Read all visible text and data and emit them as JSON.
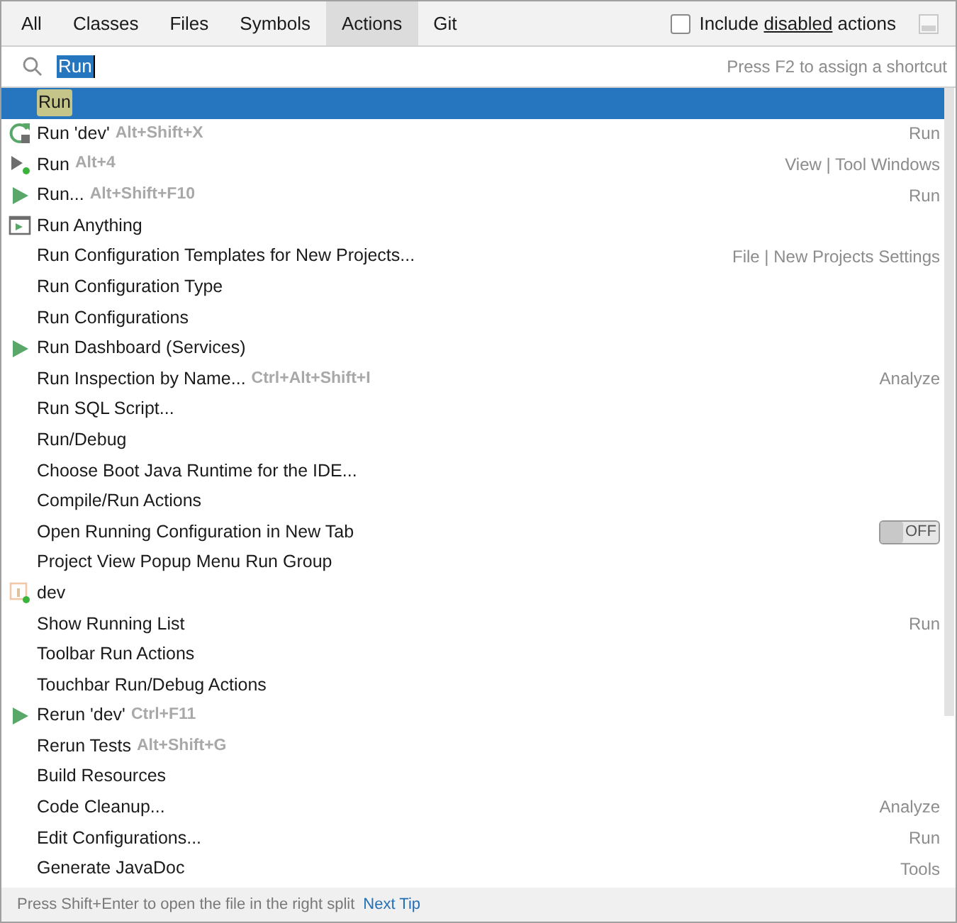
{
  "tabs": [
    {
      "label": "All",
      "selected": false
    },
    {
      "label": "Classes",
      "selected": false
    },
    {
      "label": "Files",
      "selected": false
    },
    {
      "label": "Symbols",
      "selected": false
    },
    {
      "label": "Actions",
      "selected": true
    },
    {
      "label": "Git",
      "selected": false
    }
  ],
  "include_disabled": {
    "label": "Include **disabled** actions",
    "checked": false
  },
  "search": {
    "value": "Run",
    "hint": "Press F2 to assign a shortcut"
  },
  "results": [
    {
      "name": "Run",
      "selected": true
    },
    {
      "name": "Run 'dev'",
      "shortcut": "Alt+Shift+X",
      "group": "Run",
      "kind": "rerun",
      "selected": false
    },
    {
      "name": "Run",
      "shortcut": "Alt+4",
      "group": "View | Tool Windows",
      "kind": "run-window",
      "selected": false
    },
    {
      "name": "Run...",
      "shortcut": "Alt+Shift+F10",
      "group": "Run",
      "kind": "play",
      "selected": false
    },
    {
      "name": "Run Anything",
      "kind": "run-anything",
      "selected": false
    },
    {
      "name": "Run Configuration Templates for New Projects...",
      "group": "File | New Projects Settings",
      "selected": false
    },
    {
      "name": "Run Configuration Type",
      "selected": false
    },
    {
      "name": "Run Configurations",
      "selected": false
    },
    {
      "name": "Run Dashboard (Services)",
      "kind": "play",
      "selected": false
    },
    {
      "name": "Run Inspection by Name...",
      "shortcut": "Ctrl+Alt+Shift+I",
      "group": "Analyze",
      "selected": false
    },
    {
      "name": "Run SQL Script...",
      "selected": false
    },
    {
      "name": "Run/Debug",
      "selected": false
    },
    {
      "name": "Choose Boot Java Runtime for the IDE...",
      "selected": false
    },
    {
      "name": "Compile/Run Actions",
      "selected": false
    },
    {
      "name": "Open Running Configuration in New Tab",
      "toggle": {
        "on": false,
        "label": "OFF"
      },
      "selected": false
    },
    {
      "name": "Project View Popup Menu Run Group",
      "selected": false
    },
    {
      "name": "dev",
      "kind": "config",
      "selected": false
    },
    {
      "name": "Show Running List",
      "group": "Run",
      "selected": false
    },
    {
      "name": "Toolbar Run Actions",
      "selected": false
    },
    {
      "name": "Touchbar Run/Debug Actions",
      "selected": false
    },
    {
      "name": "Rerun 'dev'",
      "shortcut": "Ctrl+F11",
      "kind": "play",
      "selected": false
    },
    {
      "name": "Rerun Tests",
      "shortcut": "Alt+Shift+G",
      "selected": false
    },
    {
      "name": "Build Resources",
      "selected": false
    },
    {
      "name": "Code Cleanup...",
      "group": "Analyze",
      "selected": false
    },
    {
      "name": "Edit Configurations...",
      "group": "Run",
      "selected": false
    },
    {
      "name": "Generate JavaDoc",
      "group": "Tools",
      "selected": false
    }
  ],
  "footer": {
    "tip": "Press Shift+Enter to open the file in the right split",
    "link": "Next Tip"
  }
}
